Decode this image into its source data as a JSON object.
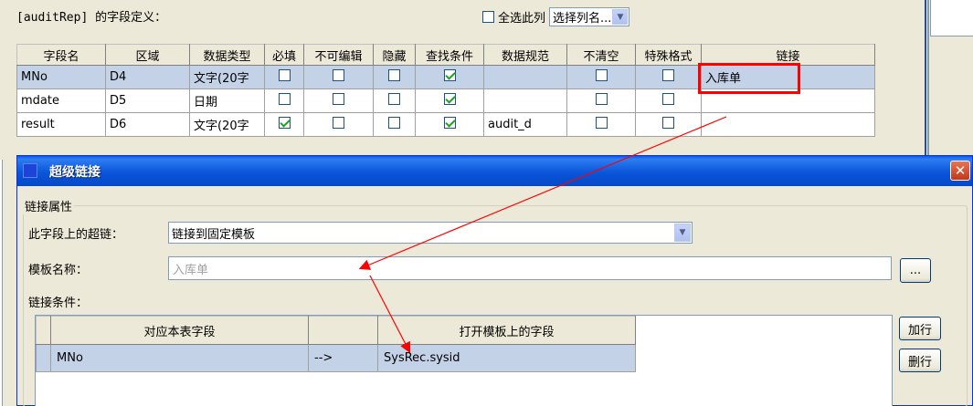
{
  "field_panel": {
    "title": "[auditRep] 的字段定义：",
    "select_all_label": "全选此列",
    "column_select": "选择列名...",
    "columns": [
      "字段名",
      "区域",
      "数据类型",
      "必填",
      "不可编辑",
      "隐藏",
      "查找条件",
      "数据规范",
      "不清空",
      "特殊格式",
      "链接"
    ],
    "rows": [
      {
        "name": "MNo",
        "area": "D4",
        "type": "文字(20字",
        "required": false,
        "readonly": false,
        "hidden": false,
        "search": true,
        "spec": "",
        "noclear": false,
        "special": false,
        "link": "入库单"
      },
      {
        "name": "mdate",
        "area": "D5",
        "type": "日期",
        "required": false,
        "readonly": false,
        "hidden": false,
        "search": true,
        "spec": "",
        "noclear": false,
        "special": false,
        "link": ""
      },
      {
        "name": "result",
        "area": "D6",
        "type": "文字(20字",
        "required": true,
        "readonly": false,
        "hidden": false,
        "search": true,
        "spec": "audit_d",
        "noclear": false,
        "special": false,
        "link": ""
      }
    ]
  },
  "dialog": {
    "title": "超级链接",
    "close_glyph": "✕",
    "group_label": "链接属性",
    "hyperlink_label": "此字段上的超链：",
    "hyperlink_value": "链接到固定模板",
    "template_label": "模板名称：",
    "template_value": "入库单",
    "browse_label": "...",
    "condition_label": "链接条件：",
    "add_row_label": "加行",
    "delete_row_label": "删行",
    "condition_columns": [
      "对应本表字段",
      "",
      "打开模板上的字段"
    ],
    "condition_rows": [
      {
        "local_field": "MNo",
        "arrow": "-->",
        "template_field": "SysRec.sysid"
      }
    ]
  },
  "colors": {
    "highlight_red": "#ff0000",
    "selection_blue": "#c4d2e8",
    "titlebar_blue": "#0a55d9",
    "check_green": "#21a121"
  },
  "icons": [
    "dropdown-arrow-icon",
    "close-icon",
    "checkbox-icon",
    "window-icon"
  ]
}
